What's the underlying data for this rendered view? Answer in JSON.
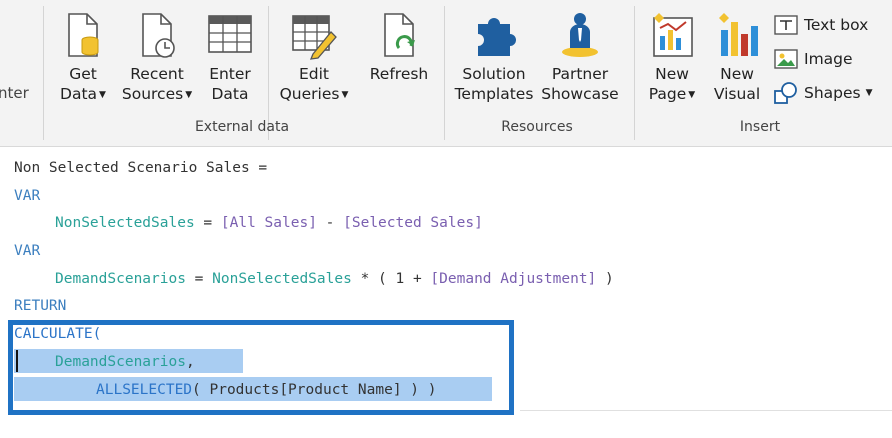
{
  "ribbon": {
    "cut_label": "nter",
    "buttons": {
      "get_data": {
        "line1": "Get",
        "line2": "Data"
      },
      "recent_sources": {
        "line1": "Recent",
        "line2": "Sources"
      },
      "enter_data": {
        "line1": "Enter",
        "line2": "Data"
      },
      "edit_queries": {
        "line1": "Edit",
        "line2": "Queries"
      },
      "refresh": {
        "line1": "Refresh"
      },
      "solution_templates": {
        "line1": "Solution",
        "line2": "Templates"
      },
      "partner_showcase": {
        "line1": "Partner",
        "line2": "Showcase"
      },
      "new_page": {
        "line1": "New",
        "line2": "Page"
      },
      "new_visual": {
        "line1": "New",
        "line2": "Visual"
      },
      "text_box": "Text box",
      "image": "Image",
      "shapes": "Shapes"
    },
    "groups": {
      "external_data": "External data",
      "resources": "Resources",
      "insert": "Insert"
    }
  },
  "editor": {
    "line1": "Non Selected Scenario Sales =",
    "line2": "VAR",
    "line3_var": "NonSelectedSales",
    "line3_eq": " = ",
    "line3_m1": "[All Sales]",
    "line3_op": " - ",
    "line3_m2": "[Selected Sales]",
    "line4": "VAR",
    "line5_var": "DemandScenarios",
    "line5_eq": " = ",
    "line5_ref": "NonSelectedSales",
    "line5_op1": " * ( 1 + ",
    "line5_m": "[Demand Adjustment]",
    "line5_close": " )",
    "line6": "RETURN",
    "line7": "CALCULATE(",
    "line8_var": "DemandScenarios",
    "line8_comma": ",",
    "line9_fn": "ALLSELECTED",
    "line9_rest": "( Products[Product Name] ) )"
  },
  "colors": {
    "keyword": "#3c7fbf",
    "variable": "#2aa198",
    "measure": "#7a5fb0",
    "selection": "#a9cdf2",
    "highlight_box": "#1f72c4"
  }
}
